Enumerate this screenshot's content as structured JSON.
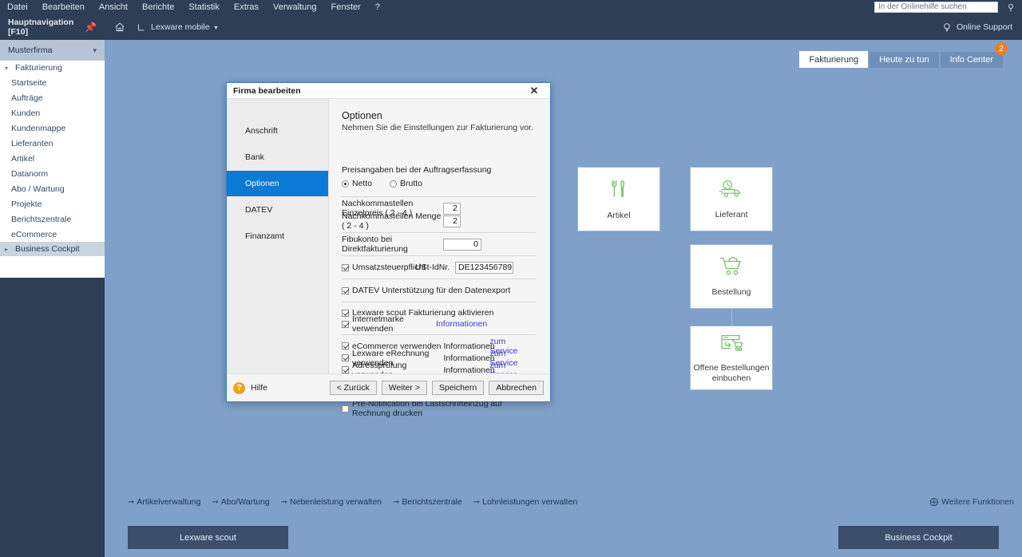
{
  "menubar": {
    "items": [
      "Datei",
      "Bearbeiten",
      "Ansicht",
      "Berichte",
      "Statistik",
      "Extras",
      "Verwaltung",
      "Fenster",
      "?"
    ],
    "search_placeholder": "In der Onlinehilfe suchen",
    "search_value": ""
  },
  "sidebar": {
    "header": "Hauptnavigation [F10]",
    "company": "Musterfirma",
    "section": "Fakturierung",
    "items": [
      "Startseite",
      "Aufträge",
      "Kunden",
      "Kundenmappe",
      "Lieferanten",
      "Artikel",
      "Datanorm",
      "Abo / Wartung",
      "Projekte",
      "Berichtszentrale",
      "eCommerce"
    ],
    "footer": "Business Cockpit"
  },
  "toolbar": {
    "mobile_label": "Lexware mobile",
    "online_support": "Online Support"
  },
  "tabs": [
    {
      "label": "Fakturierung",
      "active": true,
      "badge": ""
    },
    {
      "label": "Heute zu tun",
      "active": false,
      "badge": ""
    },
    {
      "label": "Info Center",
      "active": false,
      "badge": "2"
    }
  ],
  "cards": [
    {
      "label": "Artikel",
      "icon": "tools-icon"
    },
    {
      "label": "Lieferant",
      "icon": "delivery-truck-icon"
    },
    {
      "label": "Bestellung",
      "icon": "shopping-cart-icon"
    },
    {
      "label": "Offene Bestellungen\neinbuchen",
      "icon": "open-orders-icon"
    }
  ],
  "quicklinks": [
    "Artikelverwaltung",
    "Abo/Wartung",
    "Nebenleistung verwalten",
    "Berichtszentrale",
    "Lohnleistungen verwalten"
  ],
  "more_functions": "Weitere Funktionen",
  "bottom_buttons": {
    "left": "Lexware scout",
    "right": "Business Cockpit"
  },
  "dialog": {
    "title": "Firma bearbeiten",
    "nav": [
      {
        "label": "Anschrift",
        "active": false
      },
      {
        "label": "Bank",
        "active": false
      },
      {
        "label": "Optionen",
        "active": true
      },
      {
        "label": "DATEV",
        "active": false
      },
      {
        "label": "Finanzamt",
        "active": false
      }
    ],
    "heading": "Optionen",
    "subheading": "Nehmen Sie die Einstellungen zur Fakturierung vor.",
    "price_group_label": "Preisangaben bei der Auftragserfassung",
    "radios": [
      {
        "label": "Netto",
        "checked": true
      },
      {
        "label": "Brutto",
        "checked": false
      }
    ],
    "fields": [
      {
        "label": "Nachkommastellen Einzelpreis ( 2 - 4 )",
        "value": "2"
      },
      {
        "label": "Nachkommastellen Menge ( 2 - 4 )",
        "value": "2"
      }
    ],
    "fibu": {
      "label": "Fibukonto bei Direktfakturierung",
      "value": "0"
    },
    "ust": {
      "checkbox_label": "Umsatzsteuerpflicht",
      "checked": true,
      "field_label": "USt-IdNr.",
      "value": "DE123456789"
    },
    "datev": {
      "label": "DATEV Unterstützung für den Datenexport",
      "checked": true
    },
    "scout": [
      {
        "label": "Lexware scout Fakturierung aktivieren",
        "checked": true,
        "info": "",
        "service": ""
      },
      {
        "label": "Internetmarke verwenden",
        "checked": true,
        "info": "Informationen",
        "info_style": "link",
        "service": ""
      }
    ],
    "services": [
      {
        "label": "eCommerce verwenden",
        "checked": true,
        "info": "Informationen",
        "service": "zum Service"
      },
      {
        "label": "Lexware eRechnung verwenden",
        "checked": true,
        "info": "Informationen",
        "service": "zum Service"
      },
      {
        "label": "Adressprüfung verwenden",
        "checked": true,
        "info": "Informationen",
        "service": "zum Service"
      }
    ],
    "prenotification": {
      "label": "Pre-Notification bei Lastschrifteinzug auf Rechnung drucken",
      "checked": false
    },
    "footer": {
      "help": "Hilfe",
      "back": "< Zurück",
      "next": "Weiter >",
      "save": "Speichern",
      "cancel": "Abbrechen"
    }
  },
  "colors": {
    "chrome_dark": "#2e3e55",
    "workspace": "#7fa0c8",
    "accent_blue": "#0a7ad4",
    "badge_orange": "#ef7d22",
    "icon_green": "#78c06e",
    "link_blue": "#3a3ad0"
  }
}
